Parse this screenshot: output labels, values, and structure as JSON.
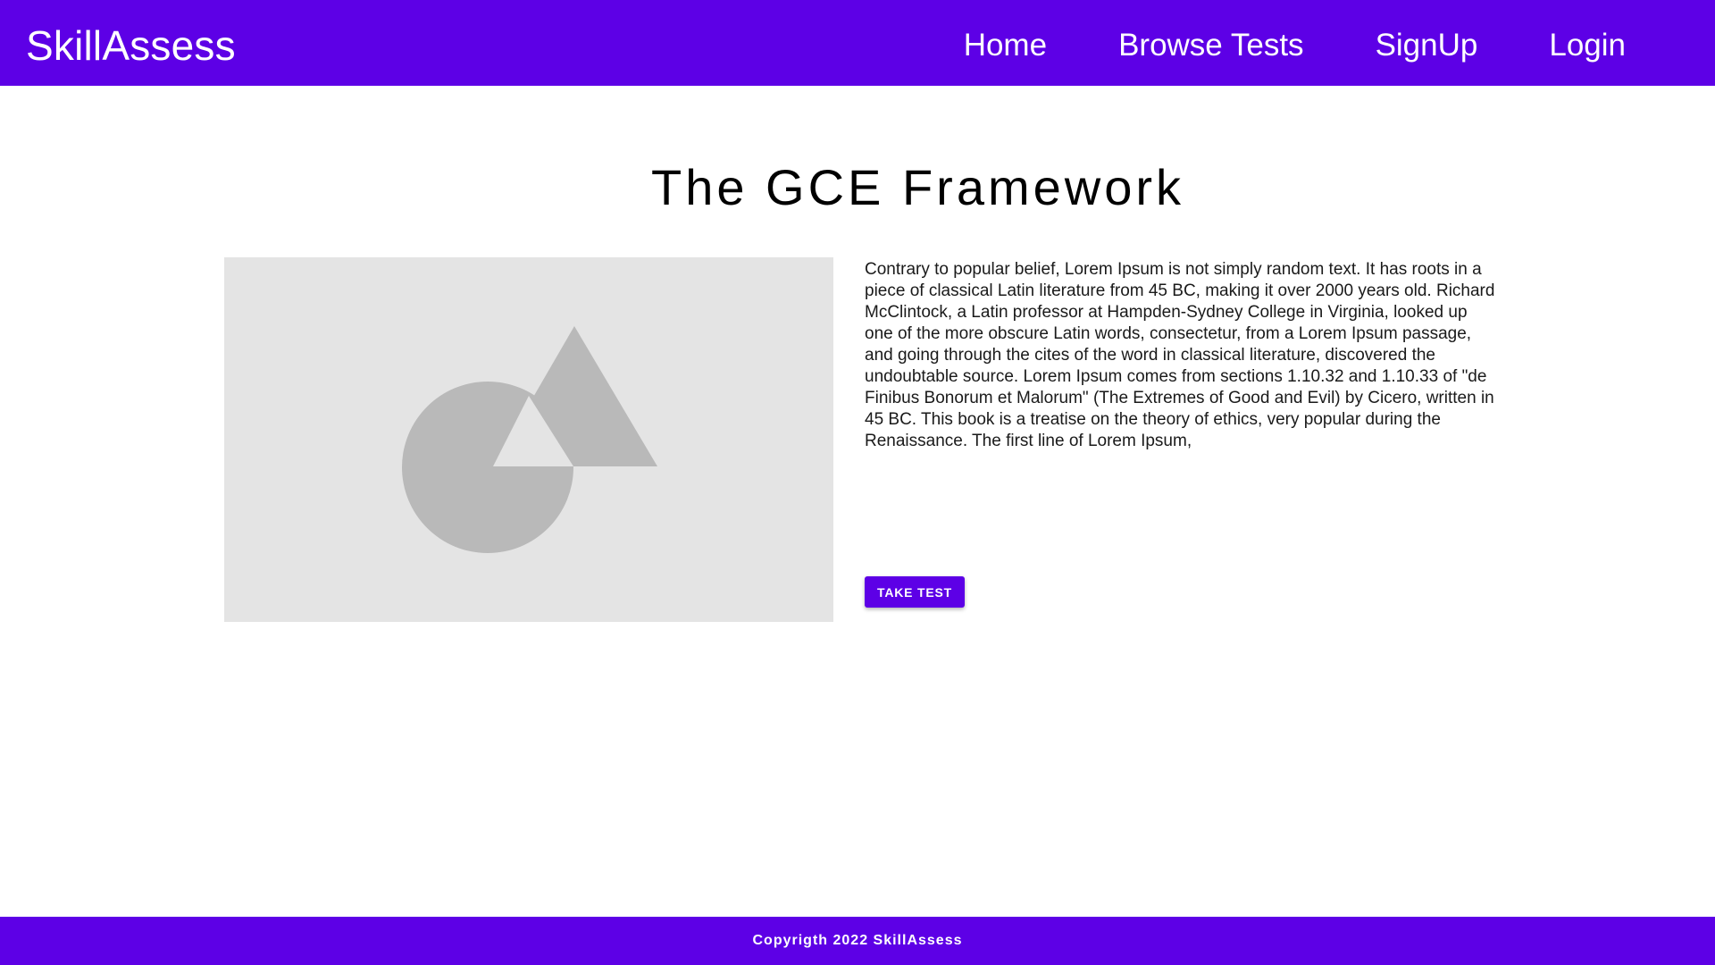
{
  "header": {
    "brand": "SkillAssess",
    "nav": [
      {
        "label": "Home"
      },
      {
        "label": "Browse Tests"
      },
      {
        "label": "SignUp"
      },
      {
        "label": "Login"
      }
    ]
  },
  "main": {
    "title": "The GCE Framework",
    "image": {
      "icon": "image-placeholder-icon"
    },
    "description": "Contrary to popular belief, Lorem Ipsum is not simply random text. It has roots in a piece of classical Latin literature from 45 BC, making it over 2000 years old. Richard McClintock, a Latin professor at Hampden-Sydney College in Virginia, looked up one of the more obscure Latin words, consectetur, from a Lorem Ipsum passage, and going through the cites of the word in classical literature, discovered the undoubtable source. Lorem Ipsum comes from sections 1.10.32 and 1.10.33 of \"de Finibus Bonorum et Malorum\" (The Extremes of Good and Evil) by Cicero, written in 45 BC. This book is a treatise on the theory of ethics, very popular during the Renaissance. The first line of Lorem Ipsum,",
    "take_test_label": "Take Test"
  },
  "footer": {
    "copyright": "Copyrigth 2022 SkillAssess"
  },
  "colors": {
    "primary": "#5d00e6",
    "placeholder_bg": "#e4e4e4",
    "placeholder_shape": "#b9b9b9"
  }
}
